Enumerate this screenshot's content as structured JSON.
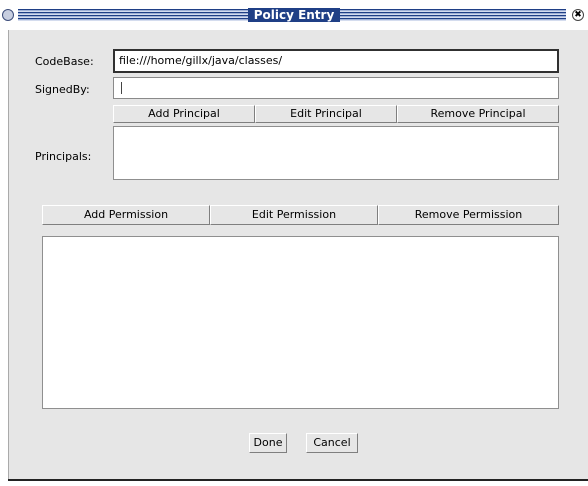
{
  "window": {
    "title": "Policy Entry",
    "close_glyph": "✖"
  },
  "form": {
    "codebase_label": "CodeBase:",
    "codebase_value": "file:///home/gillx/java/classes/",
    "signedby_label": "SignedBy:",
    "signedby_value": ""
  },
  "principal_buttons": {
    "add": "Add Principal",
    "edit": "Edit Principal",
    "remove": "Remove Principal"
  },
  "principals_label": "Principals:",
  "permission_buttons": {
    "add": "Add Permission",
    "edit": "Edit Permission",
    "remove": "Remove Permission"
  },
  "footer": {
    "done": "Done",
    "cancel": "Cancel"
  },
  "colors": {
    "titlebar": "#1f3f86",
    "panel": "#e6e6e6"
  },
  "icons": {
    "window_menu": "window-menu-icon",
    "window_close": "close-icon",
    "text_cursor": "i-beam-cursor-icon"
  }
}
